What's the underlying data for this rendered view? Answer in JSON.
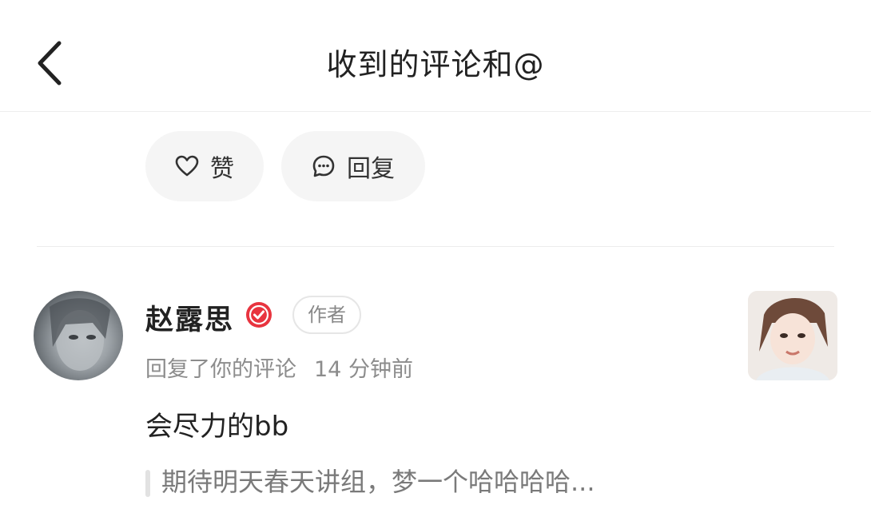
{
  "header": {
    "title": "收到的评论和@",
    "back_icon": "chevron-left-icon"
  },
  "actions": {
    "like": {
      "label": "赞",
      "icon": "heart-icon"
    },
    "reply": {
      "label": "回复",
      "icon": "chat-bubble-icon"
    }
  },
  "comment": {
    "username": "赵露思",
    "verified_icon": "verified-badge-icon",
    "verified_color": "#e8343f",
    "author_badge": "作者",
    "action_text": "回复了你的评论",
    "time": "14 分钟前",
    "content": "会尽力的bb",
    "quoted_text": "期待明天春天讲组，梦一个哈哈哈哈..."
  },
  "colors": {
    "pill_bg": "#f5f5f5",
    "meta_text": "#8c8c8c",
    "divider": "#ececec"
  }
}
